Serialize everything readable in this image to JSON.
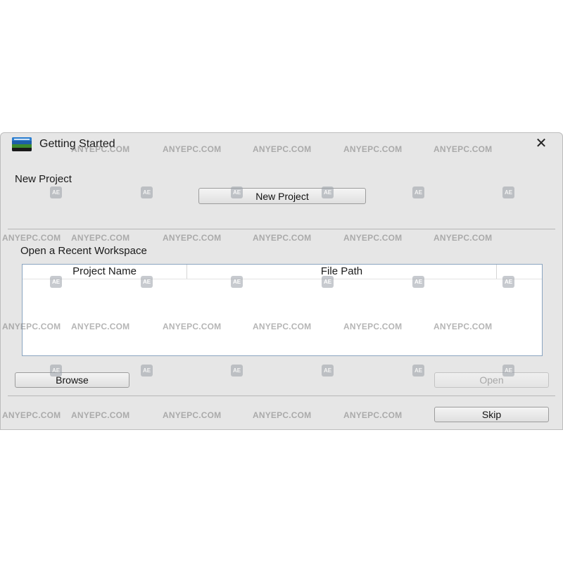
{
  "window": {
    "title": "Getting Started",
    "close_glyph": "✕",
    "icon": "app-logo-icon"
  },
  "new_project": {
    "section_label": "New Project",
    "button_label": "New Project"
  },
  "recent": {
    "section_label": "Open a Recent Workspace",
    "columns": [
      "Project Name",
      "File Path"
    ],
    "rows": []
  },
  "buttons": {
    "browse": "Browse",
    "open": "Open",
    "skip": "Skip"
  },
  "watermark": {
    "text": "ANYEPC.COM",
    "badge": "AE"
  },
  "colors": {
    "dialog_bg": "#e6e6e6",
    "table_border": "#8aa4c0"
  }
}
